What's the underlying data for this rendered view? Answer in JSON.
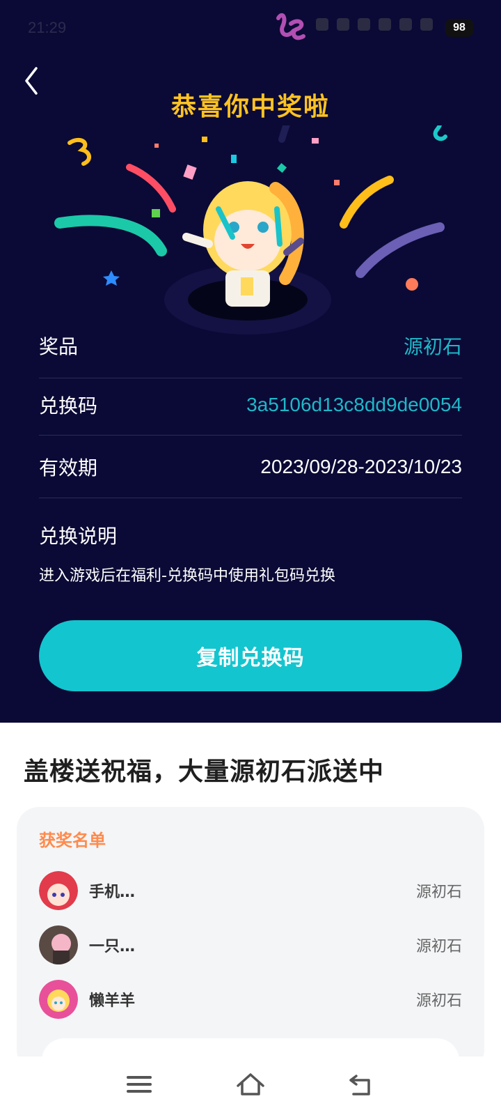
{
  "status_bar": {
    "time": "21:29",
    "battery": "98"
  },
  "header": {
    "title": "恭喜你中奖啦"
  },
  "prize": {
    "rows": [
      {
        "label": "奖品",
        "value": "源初石"
      },
      {
        "label": "兑换码",
        "value": "3a5106d13c8dd9de0054"
      },
      {
        "label": "有效期",
        "value": "2023/09/28-2023/10/23"
      }
    ],
    "desc_label": "兑换说明",
    "desc_text": "进入游戏后在福利-兑换码中使用礼包码兑换",
    "copy_button": "复制兑换码"
  },
  "promo": {
    "title": "盖楼送祝福，大量源初石派送中"
  },
  "winners": {
    "title": "获奖名单",
    "list": [
      {
        "name": "手机…",
        "prize": "源初石"
      },
      {
        "name": "一只…",
        "prize": "源初石"
      },
      {
        "name": "懒羊羊",
        "prize": "源初石"
      }
    ]
  },
  "colors": {
    "accent": "#13c5cf",
    "title_gold": "#ffc321",
    "header_bg": "#0b0a36",
    "winners_title": "#ff8a4c"
  },
  "icons": [
    "back-arrow-icon",
    "menu-icon",
    "home-icon",
    "back-nav-icon"
  ]
}
